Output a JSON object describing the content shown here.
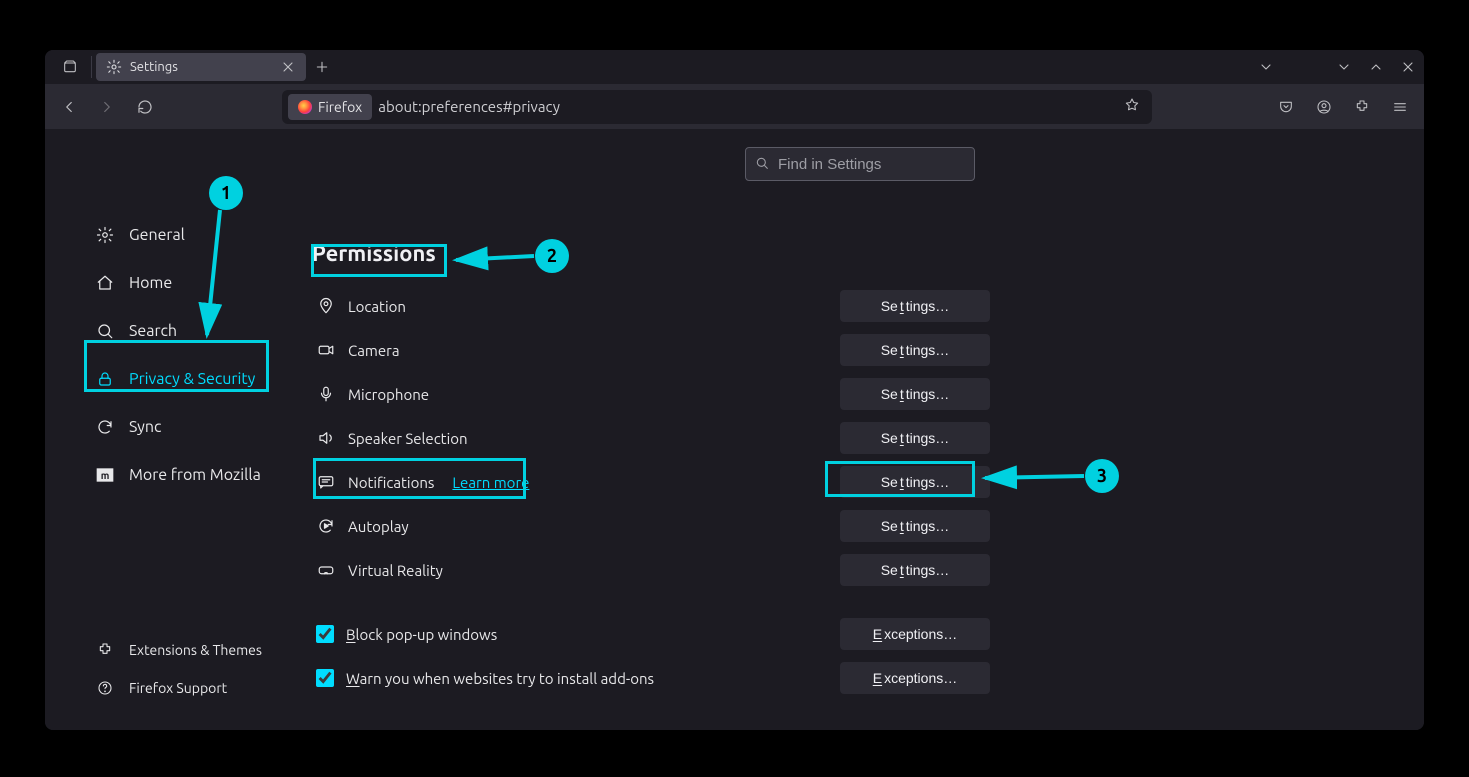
{
  "tab": {
    "title": "Settings"
  },
  "url": {
    "identity": "Firefox",
    "value": "about:preferences#privacy"
  },
  "search": {
    "placeholder": "Find in Settings"
  },
  "nav": {
    "general": "General",
    "home": "Home",
    "search": "Search",
    "privacy": "Privacy & Security",
    "sync": "Sync",
    "more": "More from Mozilla",
    "ext": "Extensions & Themes",
    "support": "Firefox Support"
  },
  "panel": {
    "heading": "Permissions",
    "location": "Location",
    "camera": "Camera",
    "microphone": "Microphone",
    "speaker": "Speaker Selection",
    "notifications": "Notifications",
    "learn_more": "Learn more",
    "autoplay": "Autoplay",
    "vr": "Virtual Reality",
    "settings_btn_pre": "Se",
    "settings_btn_u": "t",
    "settings_btn_post": "tings…",
    "block_popups_pre": "B",
    "block_popups_rest": "lock pop-up windows",
    "warn_addons_pre": "W",
    "warn_addons_rest": "arn you when websites try to install add-ons",
    "exceptions_pre": "E",
    "exceptions_rest": "xceptions…"
  },
  "annotations": {
    "n1": "1",
    "n2": "2",
    "n3": "3"
  }
}
